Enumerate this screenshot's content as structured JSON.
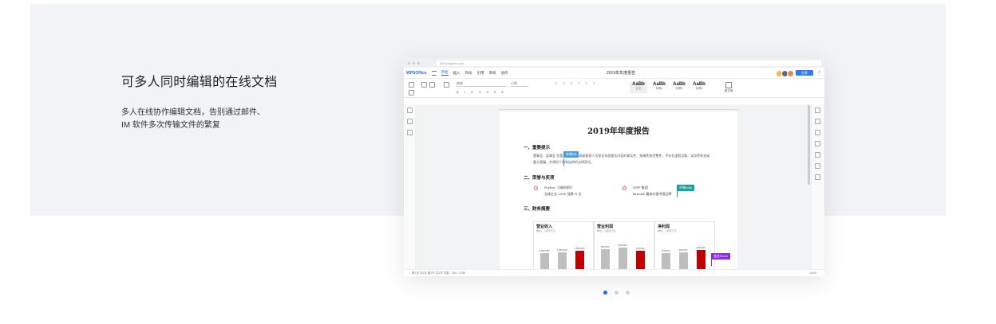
{
  "hero": {
    "title": "可多人同时编辑的在线文档",
    "desc_line1": "多人在线协作编辑文档，告别通过邮件、",
    "desc_line2": "IM 软件多次传输文件的繁复"
  },
  "window": {
    "url": "365.kingsoft.com",
    "logo": "WPSOffice",
    "menu": [
      "开始",
      "插入",
      "布局",
      "引用",
      "审阅",
      "协作"
    ],
    "doc_title": "2019年年度报告",
    "share_label": "分享",
    "toolbar": {
      "font": "宋体",
      "size": "小四",
      "styles": [
        {
          "sample": "AaBb",
          "name": "正文"
        },
        {
          "sample": "AaBb",
          "name": "标题1"
        },
        {
          "sample": "AaBb",
          "name": "标题2"
        },
        {
          "sample": "AaBb",
          "name": "标题3"
        }
      ],
      "format_label": "格式刷"
    }
  },
  "document": {
    "title": "2019年年度报告",
    "section1": "一、重要提示",
    "para1_line1": "董事会、监事会 及董事、监事、高级管理人员保证年度报告内容的真实性、准确性和完整性，不存在虚假记载、误导性陈述或",
    "para1_line2": "重大遗漏，并承担个别和连带的法律责任。",
    "section2": "二、荣誉与奖项",
    "award1_line1": "Forbes（《福布斯》）",
    "award1_line2": "全球企业 2000 强第 N 位",
    "award2_line1": "WPP 集团",
    "award2_line2": "BrandZ 最具价值中国品牌",
    "section3": "三、财务摘要",
    "cursor1": "李晓Bill",
    "cursor2": "许琳Amy",
    "cursor3": "张艺Kevin",
    "charts": [
      {
        "title": "营业收入",
        "sub": "单位：人民币万元",
        "labels": [
          "1,000,000",
          "1,200,000",
          "1,500,000"
        ],
        "values": [
          0.62,
          0.66,
          0.72
        ]
      },
      {
        "title": "营业利润",
        "sub": "单位：人民币万元",
        "labels": [
          "250,000",
          "300,000",
          "270,000"
        ],
        "values": [
          0.76,
          0.82,
          0.72
        ]
      },
      {
        "title": "净利润",
        "sub": "单位：人民币万元",
        "labels": [
          "170,000",
          "200,000",
          "230,000"
        ],
        "values": [
          0.62,
          0.66,
          0.74
        ]
      }
    ]
  },
  "status": {
    "left": "第1页 共4页   第1节 共2节   字数：283 / 2785",
    "zoom": "100%"
  },
  "carousel": {
    "active_index": 0,
    "count": 3
  }
}
